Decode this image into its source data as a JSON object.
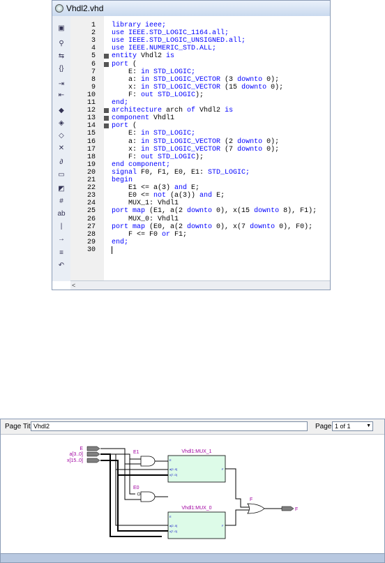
{
  "editor": {
    "title": "Vhdl2.vhd",
    "toolbar_icons": [
      "window-icon",
      "binoculars-icon",
      "find-replace-icon",
      "braces-icon",
      "indent-icon",
      "outdent-icon",
      "marker-icon",
      "marker-next-icon",
      "marker-prev-icon",
      "marker-clear-icon",
      "attach-icon",
      "insert-block-icon",
      "insert-template-icon",
      "line-numbers-icon",
      "spell-icon",
      "vertical-bar-icon",
      "insert-line-icon",
      "align-icon",
      "undo-icon"
    ],
    "line_numbers": [
      "1",
      "2",
      "3",
      "4",
      "5",
      "6",
      "7",
      "8",
      "9",
      "10",
      "11",
      "12",
      "13",
      "14",
      "15",
      "16",
      "17",
      "18",
      "19",
      "20",
      "21",
      "22",
      "23",
      "24",
      "25",
      "26",
      "27",
      "28",
      "29",
      "30"
    ],
    "lines": [
      [
        {
          "t": "library ieee;",
          "c": "kw"
        }
      ],
      [
        {
          "t": "use IEEE.STD_LOGIC_1164.all;",
          "c": "kw"
        }
      ],
      [
        {
          "t": "use IEEE.STD_LOGIC_UNSIGNED.all;",
          "c": "kw"
        }
      ],
      [
        {
          "t": "use IEEE.NUMERIC_STD.ALL;",
          "c": "kw"
        }
      ],
      [
        {
          "t": "entity ",
          "c": "kw"
        },
        {
          "t": "Vhdl2 ",
          "c": "tx"
        },
        {
          "t": "is",
          "c": "kw"
        }
      ],
      [
        {
          "t": "port ",
          "c": "kw"
        },
        {
          "t": "(",
          "c": "tx"
        }
      ],
      [
        {
          "t": "    E: ",
          "c": "tx"
        },
        {
          "t": "in STD_LOGIC;",
          "c": "kw"
        }
      ],
      [
        {
          "t": "    a: ",
          "c": "tx"
        },
        {
          "t": "in STD_LOGIC_VECTOR ",
          "c": "kw"
        },
        {
          "t": "(3 ",
          "c": "tx"
        },
        {
          "t": "downto ",
          "c": "kw"
        },
        {
          "t": "0);",
          "c": "tx"
        }
      ],
      [
        {
          "t": "    x: ",
          "c": "tx"
        },
        {
          "t": "in STD_LOGIC_VECTOR ",
          "c": "kw"
        },
        {
          "t": "(15 ",
          "c": "tx"
        },
        {
          "t": "downto ",
          "c": "kw"
        },
        {
          "t": "0);",
          "c": "tx"
        }
      ],
      [
        {
          "t": "    F: ",
          "c": "tx"
        },
        {
          "t": "out STD_LOGIC",
          "c": "kw"
        },
        {
          "t": ");",
          "c": "tx"
        }
      ],
      [
        {
          "t": "end;",
          "c": "kw"
        }
      ],
      [
        {
          "t": "architecture ",
          "c": "kw"
        },
        {
          "t": "arch ",
          "c": "tx"
        },
        {
          "t": "of ",
          "c": "kw"
        },
        {
          "t": "Vhdl2 ",
          "c": "tx"
        },
        {
          "t": "is",
          "c": "kw"
        }
      ],
      [
        {
          "t": "component ",
          "c": "kw"
        },
        {
          "t": "Vhdl1",
          "c": "tx"
        }
      ],
      [
        {
          "t": "port ",
          "c": "kw"
        },
        {
          "t": "(",
          "c": "tx"
        }
      ],
      [
        {
          "t": "    E: ",
          "c": "tx"
        },
        {
          "t": "in STD_LOGIC;",
          "c": "kw"
        }
      ],
      [
        {
          "t": "    a: ",
          "c": "tx"
        },
        {
          "t": "in STD_LOGIC_VECTOR ",
          "c": "kw"
        },
        {
          "t": "(2 ",
          "c": "tx"
        },
        {
          "t": "downto ",
          "c": "kw"
        },
        {
          "t": "0);",
          "c": "tx"
        }
      ],
      [
        {
          "t": "    x: ",
          "c": "tx"
        },
        {
          "t": "in STD_LOGIC_VECTOR ",
          "c": "kw"
        },
        {
          "t": "(7 ",
          "c": "tx"
        },
        {
          "t": "downto ",
          "c": "kw"
        },
        {
          "t": "0);",
          "c": "tx"
        }
      ],
      [
        {
          "t": "    F: ",
          "c": "tx"
        },
        {
          "t": "out STD_LOGIC",
          "c": "kw"
        },
        {
          "t": ");",
          "c": "tx"
        }
      ],
      [
        {
          "t": "end component;",
          "c": "kw"
        }
      ],
      [
        {
          "t": "signal ",
          "c": "kw"
        },
        {
          "t": "F0, F1, E0, E1: ",
          "c": "tx"
        },
        {
          "t": "STD_LOGIC;",
          "c": "kw"
        }
      ],
      [
        {
          "t": "begin",
          "c": "kw"
        }
      ],
      [
        {
          "t": "    E1 <= a(3) ",
          "c": "tx"
        },
        {
          "t": "and ",
          "c": "kw"
        },
        {
          "t": "E;",
          "c": "tx"
        }
      ],
      [
        {
          "t": "    E0 <= ",
          "c": "tx"
        },
        {
          "t": "not ",
          "c": "kw"
        },
        {
          "t": "(a(3)) ",
          "c": "tx"
        },
        {
          "t": "and ",
          "c": "kw"
        },
        {
          "t": "E;",
          "c": "tx"
        }
      ],
      [
        {
          "t": "    MUX_1: Vhdl1",
          "c": "tx"
        }
      ],
      [
        {
          "t": "port map ",
          "c": "kw"
        },
        {
          "t": "(E1, a(2 ",
          "c": "tx"
        },
        {
          "t": "downto ",
          "c": "kw"
        },
        {
          "t": "0), x(15 ",
          "c": "tx"
        },
        {
          "t": "downto ",
          "c": "kw"
        },
        {
          "t": "8), F1);",
          "c": "tx"
        }
      ],
      [
        {
          "t": "    MUX_0: Vhdl1",
          "c": "tx"
        }
      ],
      [
        {
          "t": "port map ",
          "c": "kw"
        },
        {
          "t": "(E0, a(2 ",
          "c": "tx"
        },
        {
          "t": "downto ",
          "c": "kw"
        },
        {
          "t": "0), x(7 ",
          "c": "tx"
        },
        {
          "t": "downto ",
          "c": "kw"
        },
        {
          "t": "0), F0);",
          "c": "tx"
        }
      ],
      [
        {
          "t": "    F <= F0 ",
          "c": "tx"
        },
        {
          "t": "or ",
          "c": "kw"
        },
        {
          "t": "F1;",
          "c": "tx"
        }
      ],
      [
        {
          "t": "end;",
          "c": "kw"
        }
      ],
      [
        {
          "t": "",
          "c": "tx"
        }
      ]
    ],
    "fold_lines": [
      5,
      6,
      12,
      13,
      14
    ],
    "caret_line": 30,
    "scroll_left_arrow": "<"
  },
  "viewer": {
    "page_title_label": "Page Title:",
    "page_title_value": "Vhdl2",
    "page_label": "Page:",
    "page_value": "1 of 1",
    "dropdown_arrow": "▼",
    "schematic": {
      "inputs": [
        "E",
        "a[3..0]",
        "x[15..0]"
      ],
      "output": "F",
      "signals": [
        "E1",
        "E0",
        "F"
      ],
      "instances": [
        {
          "name": "Vhdl1:MUX_1",
          "ports": [
            "E",
            "a[2..0]",
            "x[7..0]"
          ],
          "out": "F"
        },
        {
          "name": "Vhdl1:MUX_0",
          "ports": [
            "E",
            "a[2..0]",
            "x[7..0]"
          ],
          "out": "F"
        }
      ]
    }
  },
  "colors": {
    "keyword": "#0000ff",
    "signal_label": "#a000a0",
    "block_fill": "#ddfbe8"
  }
}
